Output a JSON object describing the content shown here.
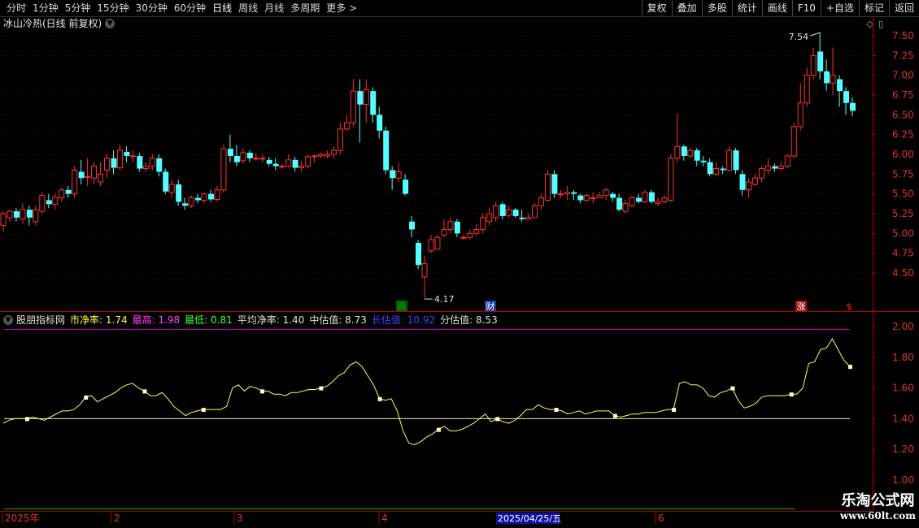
{
  "toolbar": {
    "periods": [
      "分时",
      "1分钟",
      "5分钟",
      "15分钟",
      "30分钟",
      "60分钟",
      "日线",
      "周线",
      "月线",
      "多周期",
      "更多 >"
    ],
    "active_index": 6,
    "buttons": [
      "复权",
      "叠加",
      "多股",
      "统计",
      "画线",
      "F10",
      "+自选",
      "标记",
      "返回"
    ]
  },
  "main": {
    "title": "冰山冷热(日线 前复权)",
    "high_label": "7.54",
    "low_label": "4.17",
    "markers": [
      {
        "text": "跌",
        "color": "#00a000",
        "bg": "#006000",
        "x": 494
      },
      {
        "text": "财",
        "color": "#ffffff",
        "bg": "#1a3aa0",
        "x": 603
      },
      {
        "text": "涨",
        "color": "#ffffff",
        "bg": "#a01010",
        "x": 985
      },
      {
        "text": "$",
        "color": "#ff3030",
        "bg": "#000000",
        "x": 1044
      }
    ],
    "y_ticks": [
      "7.50",
      "7.25",
      "7.00",
      "6.75",
      "6.50",
      "6.25",
      "6.00",
      "5.75",
      "5.50",
      "5.25",
      "5.00",
      "4.75",
      "4.50"
    ]
  },
  "sub": {
    "title": "股朋指标网",
    "items": [
      {
        "text": "市净率: 1.74",
        "color": "#ffff40"
      },
      {
        "text": "最高: 1.98",
        "color": "#ff40ff"
      },
      {
        "text": "最低: 0.81",
        "color": "#40ff40"
      },
      {
        "text": "平均净率: 1.40",
        "color": "#e0e0e0"
      },
      {
        "text": "中估值: 8.73",
        "color": "#e0e0e0"
      },
      {
        "text": "长估值: 10.92",
        "color": "#4040ff"
      },
      {
        "text": "分估值: 8.53",
        "color": "#e0e0e0"
      }
    ],
    "y_ticks": [
      "2.00",
      "1.80",
      "1.60",
      "1.40",
      "1.20",
      "1.00"
    ]
  },
  "time_axis": {
    "labels": [
      {
        "text": "2025年",
        "x": 6
      },
      {
        "text": "2",
        "x": 140
      },
      {
        "text": "3",
        "x": 291
      },
      {
        "text": "4",
        "x": 469
      },
      {
        "text": "6",
        "x": 809
      }
    ],
    "cursor_label": "2025/04/25/五"
  },
  "watermark": {
    "line1": "乐淘公式网",
    "line2": "www.60lt.com"
  },
  "chart_data": {
    "type": "candlestick",
    "price_ylim": [
      4.17,
      7.54
    ],
    "candles": [
      [
        5.1,
        5.25,
        5.28,
        5.02
      ],
      [
        5.2,
        5.28,
        5.3,
        5.15
      ],
      [
        5.28,
        5.2,
        5.32,
        5.15
      ],
      [
        5.18,
        5.3,
        5.38,
        5.12
      ],
      [
        5.3,
        5.2,
        5.35,
        5.1
      ],
      [
        5.15,
        5.3,
        5.35,
        5.1
      ],
      [
        5.28,
        5.48,
        5.52,
        5.25
      ],
      [
        5.42,
        5.37,
        5.5,
        5.32
      ],
      [
        5.37,
        5.46,
        5.5,
        5.3
      ],
      [
        5.45,
        5.55,
        5.58,
        5.4
      ],
      [
        5.55,
        5.5,
        5.6,
        5.45
      ],
      [
        5.5,
        5.8,
        5.85,
        5.45
      ],
      [
        5.78,
        5.7,
        5.93,
        5.62
      ],
      [
        5.72,
        5.72,
        5.95,
        5.6
      ],
      [
        5.7,
        5.85,
        5.9,
        5.62
      ],
      [
        5.65,
        5.75,
        5.9,
        5.6
      ],
      [
        5.8,
        5.95,
        6.0,
        5.7
      ],
      [
        5.95,
        5.83,
        6.05,
        5.75
      ],
      [
        5.83,
        6.05,
        6.12,
        5.8
      ],
      [
        6.03,
        5.98,
        6.1,
        5.9
      ],
      [
        5.98,
        5.98,
        6.05,
        5.9
      ],
      [
        5.98,
        5.82,
        6.02,
        5.78
      ],
      [
        5.82,
        5.85,
        5.9,
        5.78
      ],
      [
        5.85,
        5.95,
        6.0,
        5.8
      ],
      [
        5.95,
        5.78,
        6.0,
        5.72
      ],
      [
        5.78,
        5.53,
        5.82,
        5.5
      ],
      [
        5.52,
        5.62,
        5.68,
        5.45
      ],
      [
        5.62,
        5.4,
        5.68,
        5.35
      ],
      [
        5.38,
        5.35,
        5.45,
        5.3
      ],
      [
        5.35,
        5.45,
        5.48,
        5.32
      ],
      [
        5.45,
        5.42,
        5.5,
        5.38
      ],
      [
        5.42,
        5.5,
        5.52,
        5.38
      ],
      [
        5.5,
        5.43,
        5.55,
        5.4
      ],
      [
        5.43,
        5.55,
        5.6,
        5.4
      ],
      [
        5.55,
        6.07,
        6.12,
        5.52
      ],
      [
        6.07,
        5.98,
        6.25,
        5.9
      ],
      [
        5.98,
        5.9,
        6.12,
        5.85
      ],
      [
        5.92,
        6.02,
        6.08,
        5.88
      ],
      [
        6.02,
        5.95,
        6.05,
        5.9
      ],
      [
        5.95,
        5.95,
        6.02,
        5.92
      ],
      [
        5.95,
        5.95,
        6.0,
        5.9
      ],
      [
        5.93,
        5.88,
        5.97,
        5.85
      ],
      [
        5.88,
        5.85,
        5.95,
        5.8
      ],
      [
        5.85,
        5.85,
        5.88,
        5.82
      ],
      [
        5.85,
        5.93,
        6.0,
        5.83
      ],
      [
        5.93,
        5.83,
        5.97,
        5.78
      ],
      [
        5.83,
        5.85,
        5.92,
        5.78
      ],
      [
        5.85,
        5.97,
        6.0,
        5.82
      ],
      [
        5.97,
        5.98,
        6.0,
        5.9
      ],
      [
        5.98,
        6.0,
        6.02,
        5.95
      ],
      [
        5.98,
        6.0,
        6.05,
        5.95
      ],
      [
        6.0,
        6.05,
        6.1,
        5.95
      ],
      [
        6.05,
        6.32,
        6.4,
        6.0
      ],
      [
        6.32,
        6.4,
        6.5,
        6.3
      ],
      [
        6.4,
        6.8,
        6.95,
        6.35
      ],
      [
        6.8,
        6.63,
        6.95,
        6.15
      ],
      [
        6.63,
        6.82,
        6.95,
        6.4
      ],
      [
        6.8,
        6.5,
        6.85,
        6.4
      ],
      [
        6.5,
        6.3,
        6.6,
        6.2
      ],
      [
        6.3,
        5.8,
        6.35,
        5.75
      ],
      [
        5.8,
        5.7,
        5.85,
        5.55
      ],
      [
        5.7,
        5.78,
        5.9,
        5.65
      ],
      [
        5.68,
        5.5,
        5.75,
        5.48
      ],
      [
        5.15,
        5.05,
        5.22,
        4.95
      ],
      [
        4.88,
        4.6,
        4.92,
        4.55
      ],
      [
        4.45,
        4.62,
        4.72,
        4.17
      ],
      [
        4.78,
        4.92,
        4.98,
        4.75
      ],
      [
        4.8,
        4.95,
        4.98,
        4.8
      ],
      [
        4.98,
        5.05,
        5.18,
        4.95
      ],
      [
        5.05,
        5.15,
        5.2,
        5.0
      ],
      [
        5.15,
        5.0,
        5.18,
        4.95
      ],
      [
        4.95,
        4.95,
        4.98,
        4.92
      ],
      [
        4.95,
        5.0,
        5.05,
        4.92
      ],
      [
        5.0,
        5.05,
        5.12,
        4.97
      ],
      [
        5.05,
        5.2,
        5.25,
        5.0
      ],
      [
        5.15,
        5.25,
        5.32,
        5.1
      ],
      [
        5.2,
        5.35,
        5.4,
        5.15
      ],
      [
        5.37,
        5.22,
        5.4,
        5.18
      ],
      [
        5.23,
        5.3,
        5.35,
        5.2
      ],
      [
        5.3,
        5.22,
        5.32,
        5.2
      ],
      [
        5.2,
        5.18,
        5.3,
        5.15
      ],
      [
        5.18,
        5.2,
        5.25,
        5.18
      ],
      [
        5.2,
        5.35,
        5.38,
        5.2
      ],
      [
        5.35,
        5.45,
        5.5,
        5.3
      ],
      [
        5.42,
        5.75,
        5.8,
        5.4
      ],
      [
        5.75,
        5.5,
        5.8,
        5.45
      ],
      [
        5.5,
        5.5,
        5.55,
        5.45
      ],
      [
        5.5,
        5.52,
        5.6,
        5.42
      ],
      [
        5.52,
        5.5,
        5.55,
        5.42
      ],
      [
        5.48,
        5.42,
        5.5,
        5.38
      ],
      [
        5.42,
        5.48,
        5.5,
        5.4
      ],
      [
        5.45,
        5.45,
        5.52,
        5.38
      ],
      [
        5.45,
        5.48,
        5.52,
        5.45
      ],
      [
        5.48,
        5.55,
        5.58,
        5.42
      ],
      [
        5.5,
        5.45,
        5.52,
        5.4
      ],
      [
        5.45,
        5.3,
        5.5,
        5.28
      ],
      [
        5.28,
        5.38,
        5.42,
        5.25
      ],
      [
        5.35,
        5.45,
        5.48,
        5.33
      ],
      [
        5.45,
        5.4,
        5.5,
        5.38
      ],
      [
        5.4,
        5.52,
        5.55,
        5.38
      ],
      [
        5.52,
        5.4,
        5.55,
        5.38
      ],
      [
        5.38,
        5.4,
        5.45,
        5.35
      ],
      [
        5.4,
        5.45,
        5.48,
        5.38
      ],
      [
        5.42,
        5.95,
        6.0,
        5.4
      ],
      [
        5.95,
        6.1,
        6.52,
        5.9
      ],
      [
        6.1,
        5.98,
        6.12,
        5.92
      ],
      [
        5.98,
        6.05,
        6.08,
        5.95
      ],
      [
        6.05,
        5.92,
        6.08,
        5.85
      ],
      [
        5.92,
        5.9,
        5.98,
        5.85
      ],
      [
        5.9,
        5.75,
        5.95,
        5.72
      ],
      [
        5.75,
        5.82,
        5.9,
        5.72
      ],
      [
        5.82,
        5.8,
        5.85,
        5.75
      ],
      [
        5.8,
        6.05,
        6.1,
        5.78
      ],
      [
        6.05,
        5.8,
        6.08,
        5.75
      ],
      [
        5.75,
        5.55,
        5.8,
        5.48
      ],
      [
        5.55,
        5.65,
        5.7,
        5.45
      ],
      [
        5.62,
        5.7,
        5.75,
        5.6
      ],
      [
        5.7,
        5.82,
        5.85,
        5.65
      ],
      [
        5.8,
        5.85,
        5.95,
        5.75
      ],
      [
        5.85,
        5.82,
        5.88,
        5.78
      ],
      [
        5.82,
        5.85,
        5.9,
        5.8
      ],
      [
        5.85,
        5.98,
        6.0,
        5.82
      ],
      [
        5.98,
        6.35,
        6.4,
        5.95
      ],
      [
        6.35,
        6.65,
        6.9,
        6.3
      ],
      [
        6.65,
        7.0,
        7.1,
        6.6
      ],
      [
        7.0,
        7.25,
        7.35,
        6.95
      ],
      [
        7.3,
        7.05,
        7.54,
        6.95
      ],
      [
        7.05,
        6.9,
        7.2,
        6.8
      ],
      [
        6.9,
        7.0,
        7.35,
        6.75
      ],
      [
        6.95,
        6.8,
        7.0,
        6.6
      ],
      [
        6.8,
        6.65,
        6.85,
        6.5
      ],
      [
        6.65,
        6.55,
        6.72,
        6.48
      ]
    ],
    "pb_series": [
      1.37,
      1.39,
      1.4,
      1.4,
      1.4,
      1.41,
      1.4,
      1.39,
      1.41,
      1.43,
      1.45,
      1.45,
      1.46,
      1.49,
      1.54,
      1.55,
      1.51,
      1.53,
      1.55,
      1.57,
      1.6,
      1.62,
      1.63,
      1.6,
      1.58,
      1.55,
      1.55,
      1.57,
      1.53,
      1.48,
      1.45,
      1.42,
      1.44,
      1.45,
      1.46,
      1.46,
      1.46,
      1.46,
      1.48,
      1.6,
      1.62,
      1.58,
      1.61,
      1.6,
      1.58,
      1.58,
      1.56,
      1.56,
      1.55,
      1.57,
      1.57,
      1.58,
      1.59,
      1.59,
      1.6,
      1.61,
      1.64,
      1.68,
      1.7,
      1.75,
      1.77,
      1.74,
      1.68,
      1.62,
      1.53,
      1.52,
      1.53,
      1.45,
      1.32,
      1.24,
      1.23,
      1.25,
      1.28,
      1.3,
      1.33,
      1.35,
      1.32,
      1.32,
      1.33,
      1.35,
      1.37,
      1.4,
      1.43,
      1.38,
      1.4,
      1.38,
      1.37,
      1.39,
      1.42,
      1.46,
      1.46,
      1.49,
      1.47,
      1.46,
      1.46,
      1.45,
      1.43,
      1.44,
      1.45,
      1.43,
      1.44,
      1.45,
      1.45,
      1.45,
      1.42,
      1.41,
      1.42,
      1.43,
      1.43,
      1.44,
      1.44,
      1.44,
      1.45,
      1.46,
      1.46,
      1.63,
      1.64,
      1.62,
      1.62,
      1.6,
      1.55,
      1.54,
      1.57,
      1.58,
      1.6,
      1.52,
      1.47,
      1.48,
      1.5,
      1.54,
      1.55,
      1.55,
      1.55,
      1.55,
      1.56,
      1.56,
      1.6,
      1.76,
      1.77,
      1.85,
      1.86,
      1.92,
      1.85,
      1.78,
      1.74
    ],
    "pb_avg": 1.4,
    "pb_ylim": [
      1.0,
      2.0
    ]
  }
}
